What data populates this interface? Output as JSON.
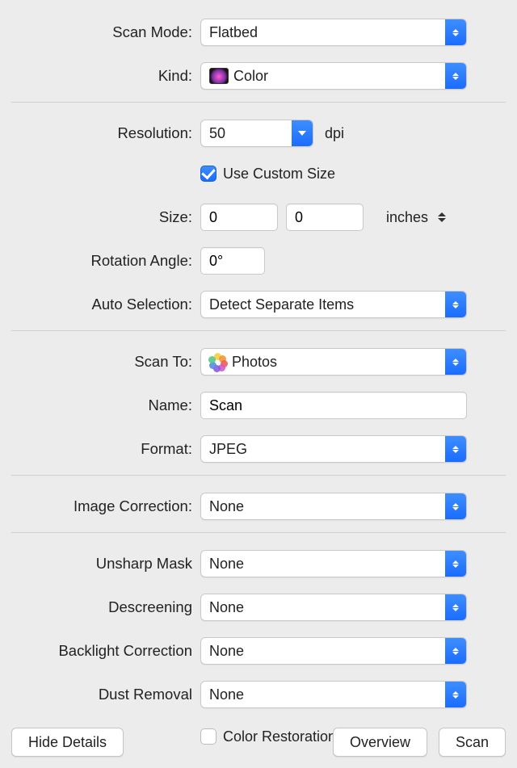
{
  "labels": {
    "scan_mode": "Scan Mode:",
    "kind": "Kind:",
    "resolution": "Resolution:",
    "dpi_suffix": "dpi",
    "use_custom_size": "Use Custom Size",
    "size": "Size:",
    "inches_suffix": "inches",
    "rotation_angle": "Rotation Angle:",
    "auto_selection": "Auto Selection:",
    "scan_to": "Scan To:",
    "name": "Name:",
    "format": "Format:",
    "image_correction": "Image Correction:",
    "unsharp_mask": "Unsharp Mask",
    "descreening": "Descreening",
    "backlight_correction": "Backlight Correction",
    "dust_removal": "Dust Removal",
    "color_restoration": "Color Restoration"
  },
  "values": {
    "scan_mode": "Flatbed",
    "kind": "Color",
    "resolution": "50",
    "use_custom_size_checked": true,
    "size_w": "0",
    "size_h": "0",
    "rotation_angle": "0°",
    "auto_selection": "Detect Separate Items",
    "scan_to": "Photos",
    "name": "Scan",
    "format": "JPEG",
    "image_correction": "None",
    "unsharp_mask": "None",
    "descreening": "None",
    "backlight_correction": "None",
    "dust_removal": "None",
    "color_restoration_checked": false
  },
  "buttons": {
    "hide_details": "Hide Details",
    "overview": "Overview",
    "scan": "Scan"
  }
}
